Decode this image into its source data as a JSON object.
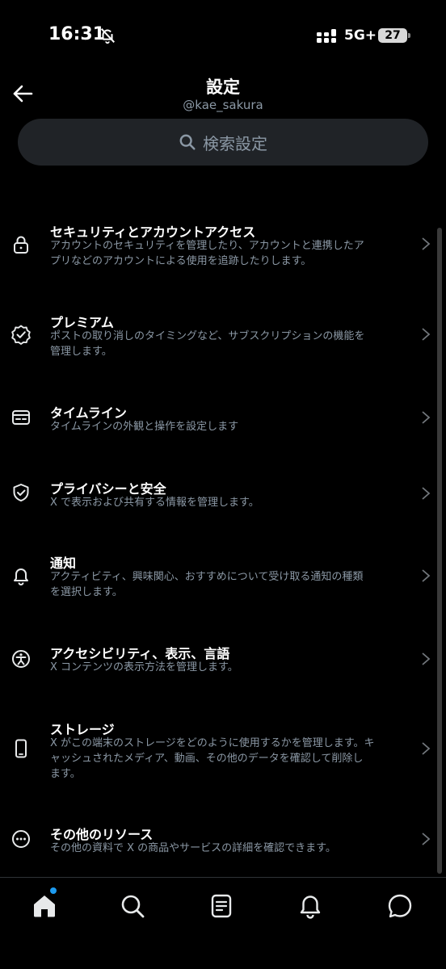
{
  "status_bar": {
    "time": "16:31",
    "network": "5G+",
    "battery": "27"
  },
  "header": {
    "title": "設定",
    "handle": "@kae_sakura"
  },
  "search": {
    "placeholder": "検索設定"
  },
  "menu": {
    "items": [
      {
        "icon": "lock-icon",
        "title": "セキュリティとアカウントアクセス",
        "desc_lines": [
          "アカウントのセキュリティを管理したり、アカウントと連携したア",
          "プリなどのアカウントによる使用を追跡したりします。"
        ]
      },
      {
        "icon": "verified-badge-icon",
        "title": "プレミアム",
        "desc_lines": [
          "ポストの取り消しのタイミングなど、サブスクリプションの機能を",
          "管理します。"
        ]
      },
      {
        "icon": "timeline-card-icon",
        "title": "タイムライン",
        "desc_lines": [
          "タイムラインの外観と操作を設定します"
        ]
      },
      {
        "icon": "shield-check-icon",
        "title": "プライバシーと安全",
        "desc_lines": [
          "X で表示および共有する情報を管理します。"
        ]
      },
      {
        "icon": "bell-icon",
        "title": "通知",
        "desc_lines": [
          "アクティビティ、興味関心、おすすめについて受け取る通知の種類",
          "を選択します。"
        ]
      },
      {
        "icon": "accessibility-icon",
        "title": "アクセシビリティ、表示、言語",
        "desc_lines": [
          "X コンテンツの表示方法を管理します。"
        ]
      },
      {
        "icon": "phone-icon",
        "title": "ストレージ",
        "desc_lines": [
          "X がこの端末のストレージをどのように使用するかを管理します。キ",
          "ャッシュされたメディア、動画、その他のデータを確認して削除し",
          "ます。"
        ]
      },
      {
        "icon": "more-circle-icon",
        "title": "その他のリソース",
        "desc_lines": [
          "その他の資料で X の商品やサービスの詳細を確認できます。"
        ]
      }
    ]
  },
  "bottom_nav": {
    "items": [
      "home-icon",
      "search-icon",
      "lists-icon",
      "notifications-icon",
      "messages-icon"
    ],
    "accent_color": "#1d9bf0"
  }
}
